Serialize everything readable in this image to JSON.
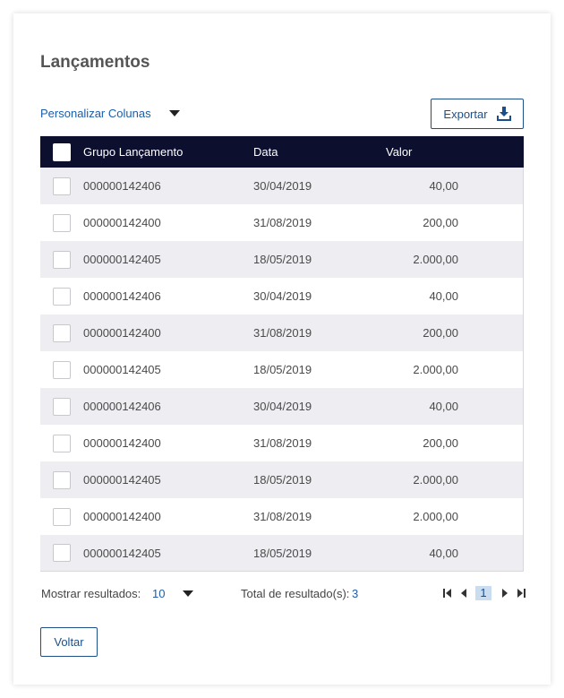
{
  "page": {
    "title": "Lançamentos",
    "customize_label": "Personalizar Colunas",
    "export_label": "Exportar",
    "back_label": "Voltar"
  },
  "table": {
    "headers": {
      "group": "Grupo Lançamento",
      "date": "Data",
      "value": "Valor"
    },
    "rows": [
      {
        "group": "000000142406",
        "date": "30/04/2019",
        "value": "40,00"
      },
      {
        "group": "000000142400",
        "date": "31/08/2019",
        "value": "200,00"
      },
      {
        "group": "000000142405",
        "date": "18/05/2019",
        "value": "2.000,00"
      },
      {
        "group": "000000142406",
        "date": "30/04/2019",
        "value": "40,00"
      },
      {
        "group": "000000142400",
        "date": "31/08/2019",
        "value": "200,00"
      },
      {
        "group": "000000142405",
        "date": "18/05/2019",
        "value": "2.000,00"
      },
      {
        "group": "000000142406",
        "date": "30/04/2019",
        "value": "40,00"
      },
      {
        "group": "000000142400",
        "date": "31/08/2019",
        "value": "200,00"
      },
      {
        "group": "000000142405",
        "date": "18/05/2019",
        "value": "2.000,00"
      },
      {
        "group": "000000142400",
        "date": "31/08/2019",
        "value": "2.000,00"
      },
      {
        "group": "000000142405",
        "date": "18/05/2019",
        "value": "40,00"
      }
    ]
  },
  "footer": {
    "show_label": "Mostrar resultados:",
    "show_value": "10",
    "total_label": "Total de resultado(s):",
    "total_value": "3",
    "current_page": "1"
  },
  "colors": {
    "header_bg": "#0c0f2e",
    "accent": "#1c5ea8",
    "row_alt": "#eeeef2",
    "page_highlight": "#c9dcf0"
  },
  "icons": [
    "caret-down-icon",
    "download-icon",
    "first-page-icon",
    "prev-page-icon",
    "next-page-icon",
    "last-page-icon"
  ]
}
